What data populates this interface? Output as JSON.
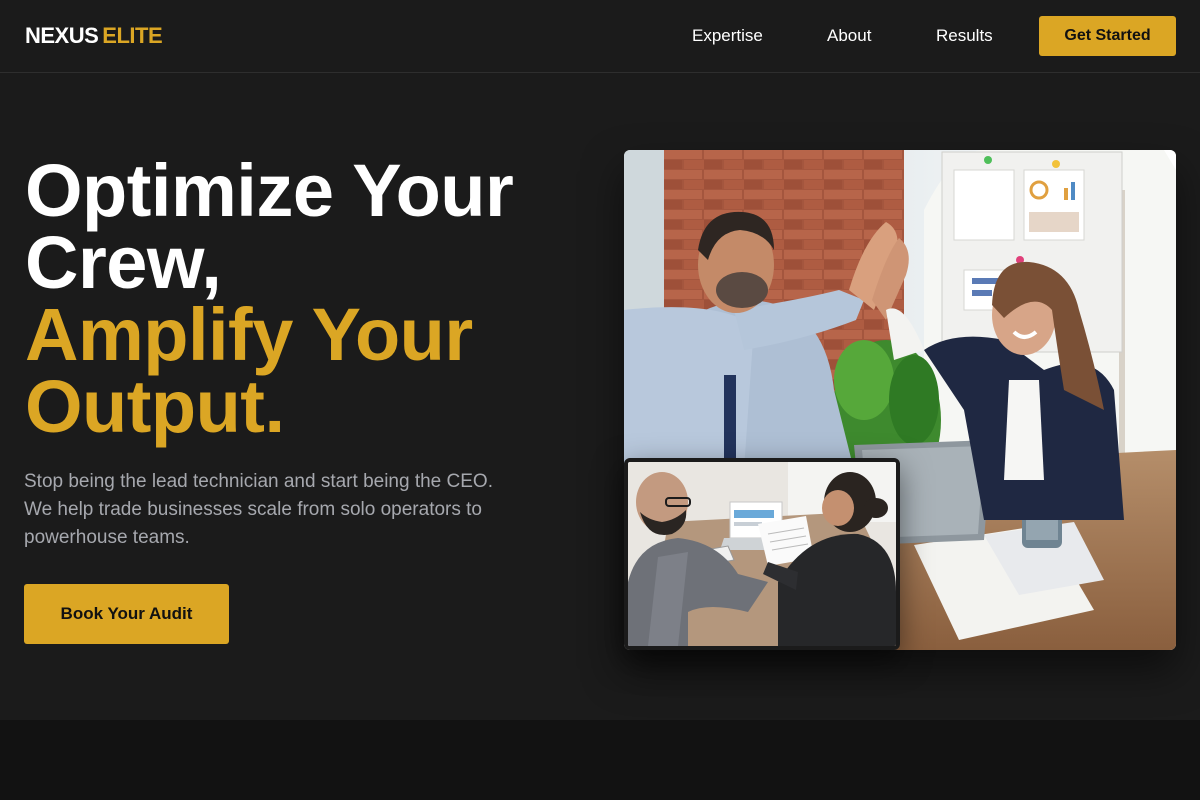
{
  "brand": {
    "name_part1": "NEXUS",
    "name_part2": "ELITE",
    "accent_color": "#dba624"
  },
  "nav": {
    "items": [
      {
        "label": "Expertise"
      },
      {
        "label": "About"
      },
      {
        "label": "Results"
      }
    ],
    "cta_label": "Get Started"
  },
  "hero": {
    "title_line1": "Optimize Your",
    "title_line2": "Crew,",
    "title_line3": "Amplify Your",
    "title_line4": "Output.",
    "subtitle": "Stop being the lead technician and start being the CEO. We help trade businesses scale from solo operators to powerhouse teams.",
    "cta_label": "Book Your Audit"
  },
  "images": {
    "main_photo": "office-high-five-photo",
    "inset_photo": "meeting-documents-photo"
  }
}
